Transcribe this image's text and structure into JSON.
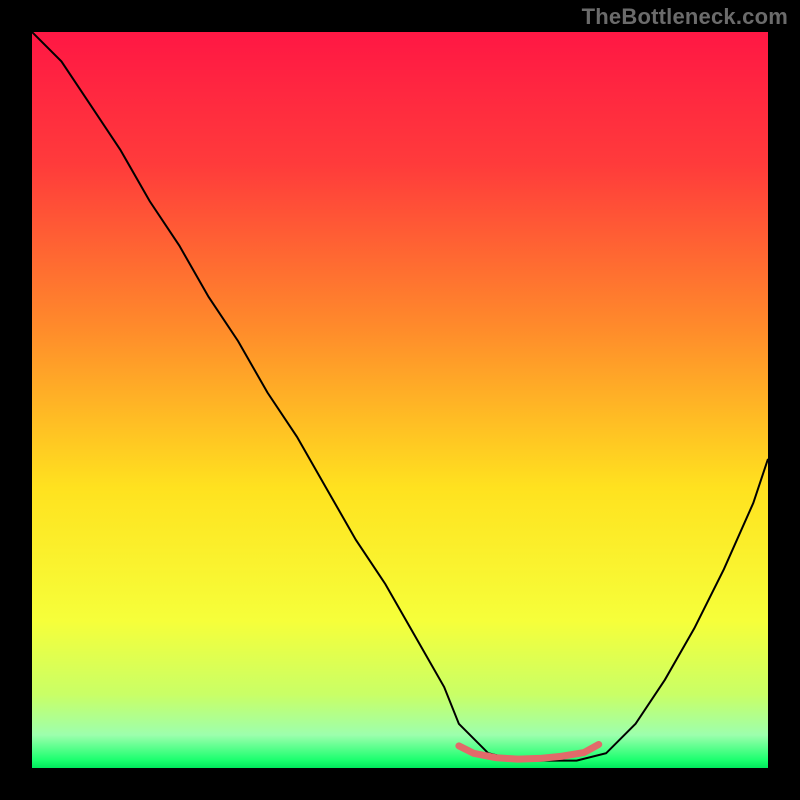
{
  "watermark": "TheBottleneck.com",
  "chart_data": {
    "type": "line",
    "title": "",
    "xlabel": "",
    "ylabel": "",
    "xlim": [
      0,
      100
    ],
    "ylim": [
      0,
      100
    ],
    "grid": false,
    "legend": false,
    "series": [
      {
        "name": "curve",
        "color": "#000000",
        "x": [
          0,
          4,
          8,
          12,
          16,
          20,
          24,
          28,
          32,
          36,
          40,
          44,
          48,
          52,
          56,
          58,
          62,
          66,
          70,
          74,
          78,
          82,
          86,
          90,
          94,
          98,
          100
        ],
        "y": [
          100,
          96,
          90,
          84,
          77,
          71,
          64,
          58,
          51,
          45,
          38,
          31,
          25,
          18,
          11,
          6,
          2,
          1,
          1,
          1,
          2,
          6,
          12,
          19,
          27,
          36,
          42
        ]
      },
      {
        "name": "highlight-bottom",
        "color": "#e26a6a",
        "x": [
          58,
          60,
          63,
          66,
          69,
          72,
          75,
          77
        ],
        "y": [
          3.0,
          2.0,
          1.4,
          1.2,
          1.3,
          1.6,
          2.1,
          3.2
        ]
      }
    ],
    "background_gradient": {
      "stops": [
        {
          "offset": 0.0,
          "color": "#ff1744"
        },
        {
          "offset": 0.18,
          "color": "#ff3b3b"
        },
        {
          "offset": 0.4,
          "color": "#ff8a2b"
        },
        {
          "offset": 0.62,
          "color": "#ffe21f"
        },
        {
          "offset": 0.8,
          "color": "#f6ff3a"
        },
        {
          "offset": 0.9,
          "color": "#c9ff66"
        },
        {
          "offset": 0.955,
          "color": "#9dffad"
        },
        {
          "offset": 0.99,
          "color": "#18ff6d"
        },
        {
          "offset": 1.0,
          "color": "#00e85c"
        }
      ]
    }
  }
}
